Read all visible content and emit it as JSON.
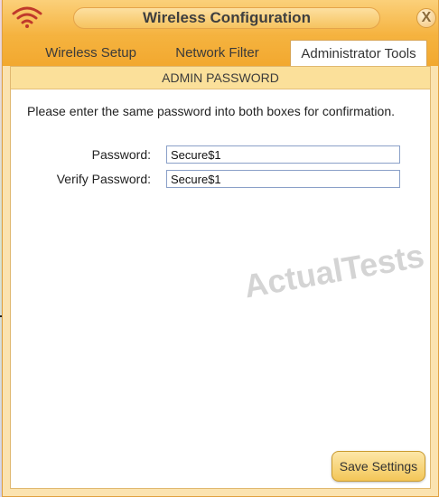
{
  "window": {
    "title": "Wireless Configuration",
    "close_symbol": "X"
  },
  "tabs": [
    {
      "label": "Wireless Setup",
      "active": false
    },
    {
      "label": "Network Filter",
      "active": false
    },
    {
      "label": "Administrator Tools",
      "active": true
    }
  ],
  "section": {
    "header": "ADMIN PASSWORD",
    "instructions": "Please enter the same password into both boxes for confirmation."
  },
  "form": {
    "password_label": "Password:",
    "password_value": "Secure$1",
    "verify_label": "Verify Password:",
    "verify_value": "Secure$1"
  },
  "watermark": "ActualTests",
  "actions": {
    "save_label": "Save Settings"
  },
  "icons": {
    "title_icon": "wifi-icon",
    "close_icon": "close-icon"
  },
  "colors": {
    "accent": "#f5b23e",
    "header_bg": "#fbe09a",
    "button_bg": "#f3c658"
  }
}
